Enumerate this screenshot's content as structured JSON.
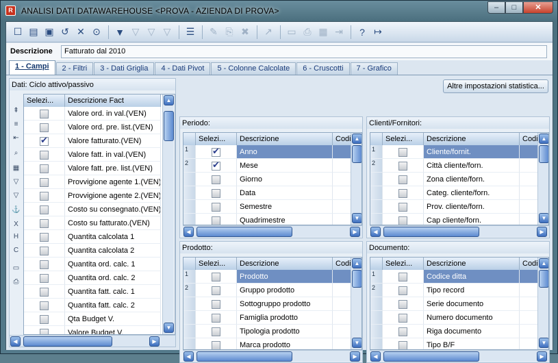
{
  "window": {
    "title": "ANALISI DATI DATAWAREHOUSE <PROVA - AZIENDA DI PROVA>",
    "controls": {
      "minimize": "–",
      "maximize": "□",
      "close": "✕"
    }
  },
  "toolbar": {
    "buttons": [
      {
        "name": "new-icon",
        "glyph": "☐"
      },
      {
        "name": "open-folder-icon",
        "glyph": "▤"
      },
      {
        "name": "save-icon",
        "glyph": "▣"
      },
      {
        "name": "undo-icon",
        "glyph": "↺"
      },
      {
        "name": "delete-icon",
        "glyph": "✕"
      },
      {
        "name": "binoculars-icon",
        "glyph": "⊙"
      },
      {
        "name": "sep",
        "glyph": ""
      },
      {
        "name": "filter-add-icon",
        "glyph": "▼"
      },
      {
        "name": "filter-remove-icon",
        "glyph": "▽",
        "disabled": true
      },
      {
        "name": "filter-clear-icon",
        "glyph": "▽",
        "disabled": true
      },
      {
        "name": "filter-icon",
        "glyph": "▽",
        "disabled": true
      },
      {
        "name": "sep",
        "glyph": ""
      },
      {
        "name": "list-options-icon",
        "glyph": "☰"
      },
      {
        "name": "sep",
        "glyph": ""
      },
      {
        "name": "edit-icon",
        "glyph": "✎",
        "disabled": true
      },
      {
        "name": "copy-icon",
        "glyph": "⎘",
        "disabled": true
      },
      {
        "name": "remove-icon",
        "glyph": "✖",
        "disabled": true
      },
      {
        "name": "sep",
        "glyph": ""
      },
      {
        "name": "chart-icon",
        "glyph": "↗",
        "disabled": true
      },
      {
        "name": "sep",
        "glyph": ""
      },
      {
        "name": "monitor-icon",
        "glyph": "▭",
        "disabled": true
      },
      {
        "name": "print-icon",
        "glyph": "⎙",
        "disabled": true
      },
      {
        "name": "excel-icon",
        "glyph": "▦",
        "disabled": true
      },
      {
        "name": "export-icon",
        "glyph": "⇥",
        "disabled": true
      },
      {
        "name": "sep",
        "glyph": ""
      },
      {
        "name": "help-icon",
        "glyph": "?"
      },
      {
        "name": "exit-icon",
        "glyph": "↦"
      }
    ]
  },
  "description": {
    "label": "Descrizione",
    "value": "Fatturato dal 2010"
  },
  "tabs": [
    {
      "label": "1 - Campi",
      "active": true
    },
    {
      "label": "2 - Filtri"
    },
    {
      "label": "3 - Dati Griglia"
    },
    {
      "label": "4 - Dati Pivot"
    },
    {
      "label": "5 - Colonne Calcolate"
    },
    {
      "label": "6 - Cruscotti"
    },
    {
      "label": "7 - Grafico"
    }
  ],
  "fact_panel": {
    "caption": "Dati: Ciclo attivo/passivo",
    "headers": [
      "Selezi...",
      "Descrizione Fact"
    ],
    "rows": [
      {
        "checked": false,
        "label": "Valore ord. in val.(VEN)"
      },
      {
        "checked": false,
        "label": "Valore ord. pre. list.(VEN)"
      },
      {
        "checked": true,
        "label": "Valore fatturato.(VEN)"
      },
      {
        "checked": false,
        "label": "Valore fatt. in val.(VEN)"
      },
      {
        "checked": false,
        "label": "Valore fatt. pre. list.(VEN)"
      },
      {
        "checked": false,
        "label": "Provvigione agente 1.(VEN)"
      },
      {
        "checked": false,
        "label": "Provvigione agente 2.(VEN)"
      },
      {
        "checked": false,
        "label": "Costo su consegnato.(VEN)"
      },
      {
        "checked": false,
        "label": "Costo su fatturato.(VEN)"
      },
      {
        "checked": false,
        "label": "Quantita calcolata 1"
      },
      {
        "checked": false,
        "label": "Quantita calcolata 2"
      },
      {
        "checked": false,
        "label": "Quantita ord. calc. 1"
      },
      {
        "checked": false,
        "label": "Quantita ord. calc. 2"
      },
      {
        "checked": false,
        "label": "Quantita fatt. calc. 1"
      },
      {
        "checked": false,
        "label": "Quantita fatt. calc. 2"
      },
      {
        "checked": false,
        "label": "Qta Budget V."
      },
      {
        "checked": false,
        "label": "Valore Budget V."
      }
    ],
    "side_icons": [
      "sort-up-icon",
      "sort-down-icon",
      "move-up-icon",
      "find-icon",
      "grid-icon",
      "filter-icon",
      "filter-x-icon",
      "anchor-icon",
      "x-sort-icon",
      "h-sort-icon",
      "c-sort-icon",
      "monitor-icon",
      "print-icon"
    ],
    "side_glyphs": [
      "⇞",
      "≡",
      "⇤",
      "⌕",
      "▦",
      "▽",
      "▽",
      "⚓",
      "X",
      "H",
      "C",
      "▭",
      "⎙"
    ]
  },
  "stats_button": "Altre impostazioni statistica...",
  "dim_panels": [
    {
      "caption": "Periodo:",
      "headers": [
        "Selezi...",
        "Descrizione",
        "Codi"
      ],
      "rows": [
        {
          "ind": "1",
          "checked": true,
          "label": "Anno",
          "selected": true
        },
        {
          "ind": "2",
          "checked": true,
          "label": "Mese"
        },
        {
          "ind": "",
          "checked": false,
          "label": "Giorno"
        },
        {
          "ind": "",
          "checked": false,
          "label": "Data"
        },
        {
          "ind": "",
          "checked": false,
          "label": "Semestre"
        },
        {
          "ind": "",
          "checked": false,
          "label": "Quadrimestre"
        }
      ]
    },
    {
      "caption": "Clienti/Fornitori:",
      "headers": [
        "Selezi...",
        "Descrizione",
        "Codi"
      ],
      "rows": [
        {
          "ind": "1",
          "checked": false,
          "label": "Cliente/fornit.",
          "selected": true
        },
        {
          "ind": "2",
          "checked": false,
          "label": "Città cliente/forn."
        },
        {
          "ind": "",
          "checked": false,
          "label": "Zona cliente/forn."
        },
        {
          "ind": "",
          "checked": false,
          "label": "Categ. cliente/forn."
        },
        {
          "ind": "",
          "checked": false,
          "label": "Prov. cliente/forn."
        },
        {
          "ind": "",
          "checked": false,
          "label": "Cap cliente/forn."
        }
      ]
    },
    {
      "caption": "Prodotto:",
      "headers": [
        "Selezi...",
        "Descrizione",
        "Codi"
      ],
      "rows": [
        {
          "ind": "1",
          "checked": false,
          "label": "Prodotto",
          "selected": true
        },
        {
          "ind": "2",
          "checked": false,
          "label": "Gruppo prodotto"
        },
        {
          "ind": "",
          "checked": false,
          "label": "Sottogruppo prodotto"
        },
        {
          "ind": "",
          "checked": false,
          "label": "Famiglia prodotto"
        },
        {
          "ind": "",
          "checked": false,
          "label": "Tipologia prodotto"
        },
        {
          "ind": "",
          "checked": false,
          "label": "Marca prodotto"
        }
      ]
    },
    {
      "caption": "Documento:",
      "headers": [
        "Selezi...",
        "Descrizione",
        "Codi"
      ],
      "rows": [
        {
          "ind": "1",
          "checked": false,
          "label": "Codice ditta",
          "selected": true
        },
        {
          "ind": "2",
          "checked": false,
          "label": "Tipo record"
        },
        {
          "ind": "",
          "checked": false,
          "label": "Serie documento"
        },
        {
          "ind": "",
          "checked": false,
          "label": "Numero documento"
        },
        {
          "ind": "",
          "checked": false,
          "label": "Riga documento"
        },
        {
          "ind": "",
          "checked": false,
          "label": "Tipo B/F"
        }
      ]
    }
  ]
}
